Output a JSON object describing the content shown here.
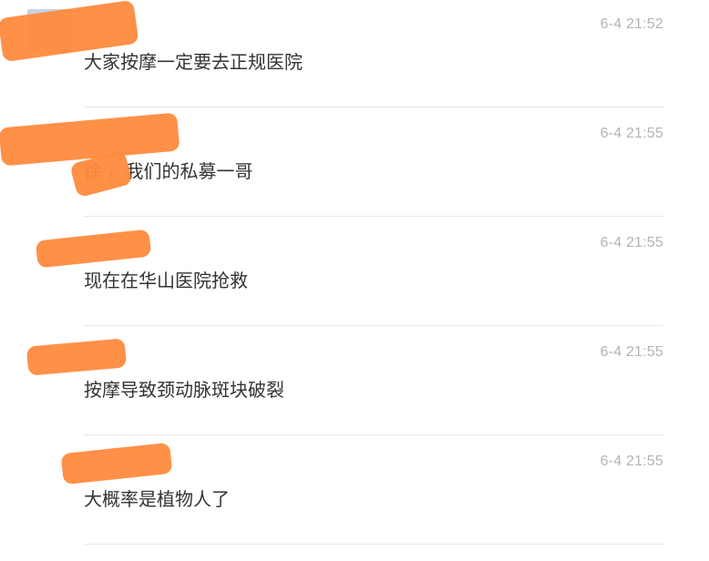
{
  "messages": [
    {
      "time": "6-4 21:52",
      "text": "大家按摩一定要去正规医院"
    },
    {
      "time": "6-4 21:55",
      "text": "徐 ，我们的私募一哥"
    },
    {
      "time": "6-4 21:55",
      "text": "现在在华山医院抢救"
    },
    {
      "time": "6-4 21:55",
      "text": "按摩导致颈动脉斑块破裂"
    },
    {
      "time": "6-4 21:55",
      "text": "大概率是植物人了"
    }
  ],
  "colors": {
    "redaction": "#ff8a3d",
    "time": "#b4b4b4",
    "text": "#333333",
    "divider": "#e8e8e8"
  }
}
